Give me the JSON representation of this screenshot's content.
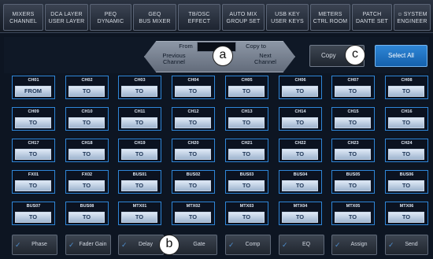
{
  "top_menu": [
    {
      "line1": "MIXERS",
      "line2": "CHANNEL"
    },
    {
      "line1": "DCA LAYER",
      "line2": "USER LAYER"
    },
    {
      "line1": "PEQ",
      "line2": "DYNAMIC"
    },
    {
      "line1": "GEQ",
      "line2": "BUS MIXER"
    },
    {
      "line1": "TB/OSC",
      "line2": "EFFECT"
    },
    {
      "line1": "AUTO MIX",
      "line2": "GROUP SET"
    },
    {
      "line1": "USB KEY",
      "line2": "USER KEYS"
    },
    {
      "line1": "METERS",
      "line2": "CTRL ROOM"
    },
    {
      "line1": "PATCH",
      "line2": "DANTE SET"
    },
    {
      "line1": "SYSTEM",
      "line2": "ENGINEER"
    }
  ],
  "nav": {
    "from_label": "From",
    "copy_to_label": "Copy to",
    "previous_line1": "Previous",
    "previous_line2": "Channel",
    "next_line1": "Next",
    "next_line2": "Channel"
  },
  "copy_label": "Copy",
  "select_all_label": "Select All",
  "callouts": {
    "a": "a",
    "b": "b",
    "c": "c"
  },
  "channels": [
    {
      "name": "CH01",
      "action": "FROM"
    },
    {
      "name": "CH02",
      "action": "TO"
    },
    {
      "name": "CH03",
      "action": "TO"
    },
    {
      "name": "CH04",
      "action": "TO"
    },
    {
      "name": "CH05",
      "action": "TO"
    },
    {
      "name": "CH06",
      "action": "TO"
    },
    {
      "name": "CH07",
      "action": "TO"
    },
    {
      "name": "CH08",
      "action": "TO"
    },
    {
      "name": "CH09",
      "action": "TO"
    },
    {
      "name": "CH10",
      "action": "TO"
    },
    {
      "name": "CH11",
      "action": "TO"
    },
    {
      "name": "CH12",
      "action": "TO"
    },
    {
      "name": "CH13",
      "action": "TO"
    },
    {
      "name": "CH14",
      "action": "TO"
    },
    {
      "name": "CH15",
      "action": "TO"
    },
    {
      "name": "CH16",
      "action": "TO"
    },
    {
      "name": "CH17",
      "action": "TO"
    },
    {
      "name": "CH18",
      "action": "TO"
    },
    {
      "name": "CH19",
      "action": "TO"
    },
    {
      "name": "CH20",
      "action": "TO"
    },
    {
      "name": "CH21",
      "action": "TO"
    },
    {
      "name": "CH22",
      "action": "TO"
    },
    {
      "name": "CH23",
      "action": "TO"
    },
    {
      "name": "CH24",
      "action": "TO"
    },
    {
      "name": "FX01",
      "action": "TO"
    },
    {
      "name": "FX02",
      "action": "TO"
    },
    {
      "name": "BUS01",
      "action": "TO"
    },
    {
      "name": "BUS02",
      "action": "TO"
    },
    {
      "name": "BUS03",
      "action": "TO"
    },
    {
      "name": "BUS04",
      "action": "TO"
    },
    {
      "name": "BUS05",
      "action": "TO"
    },
    {
      "name": "BUS06",
      "action": "TO"
    },
    {
      "name": "BUS07",
      "action": "TO"
    },
    {
      "name": "BUS08",
      "action": "TO"
    },
    {
      "name": "MTX01",
      "action": "TO"
    },
    {
      "name": "MTX02",
      "action": "TO"
    },
    {
      "name": "MTX03",
      "action": "TO"
    },
    {
      "name": "MTX04",
      "action": "TO"
    },
    {
      "name": "MTX05",
      "action": "TO"
    },
    {
      "name": "MTX06",
      "action": "TO"
    }
  ],
  "toggles": [
    {
      "label": "Phase"
    },
    {
      "label": "Fader Gain"
    },
    {
      "label": "Delay"
    },
    {
      "label": "Gate"
    },
    {
      "label": "Comp"
    },
    {
      "label": "EQ"
    },
    {
      "label": "Assign"
    },
    {
      "label": "Send"
    }
  ],
  "colors": {
    "accent": "#2e86d8",
    "select_all": "#1f74c4",
    "background": "#0d1522"
  }
}
